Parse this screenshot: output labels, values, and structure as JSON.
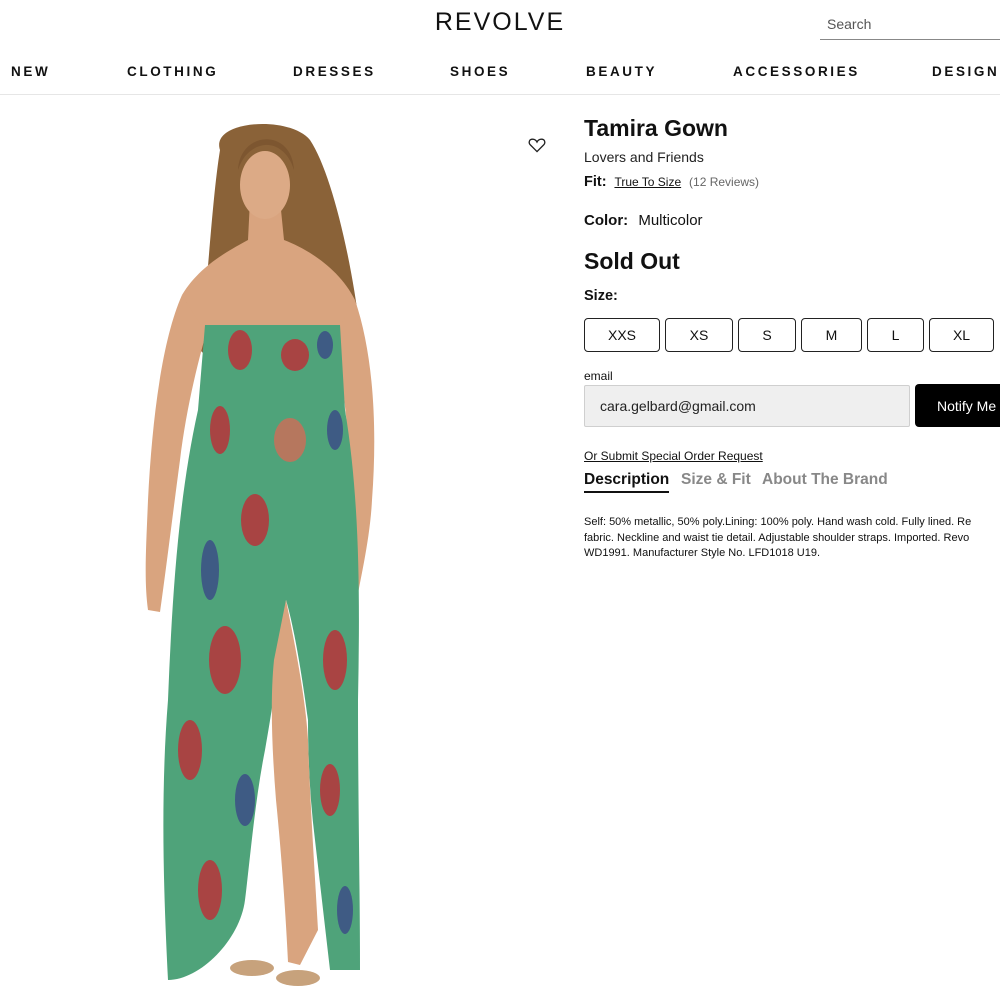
{
  "header": {
    "logo": "REVOLVE",
    "search_placeholder": "Search"
  },
  "nav": {
    "items": [
      "NEW",
      "CLOTHING",
      "DRESSES",
      "SHOES",
      "BEAUTY",
      "ACCESSORIES",
      "DESIGNERS"
    ]
  },
  "product": {
    "title": "Tamira Gown",
    "brand": "Lovers and Friends",
    "fit_label": "Fit:",
    "fit_value": "True To Size",
    "reviews": "(12 Reviews)",
    "color_label": "Color:",
    "color_value": "Multicolor",
    "status": "Sold Out",
    "size_label": "Size:",
    "sizes": [
      "XXS",
      "XS",
      "S",
      "M",
      "L",
      "XL"
    ],
    "email_label": "email",
    "email_value": "cara.gelbard@gmail.com",
    "notify_label": "Notify Me",
    "special_order": "Or Submit Special Order Request",
    "tabs": [
      "Description",
      "Size & Fit",
      "About The Brand"
    ],
    "description_lines": [
      "Self: 50% metallic, 50% poly.Lining: 100% poly. Hand wash cold. Fully lined. Re",
      "fabric. Neckline and waist tie detail. Adjustable shoulder straps. Imported. Revo",
      "WD1991. Manufacturer Style No. LFD1018 U19."
    ]
  },
  "colors": {
    "dress_green": "#4fa37a",
    "dress_red": "#b8343a",
    "dress_blue": "#3c4f86",
    "skin": "#d9a47f",
    "hair": "#8a6238",
    "button_black": "#000000"
  }
}
